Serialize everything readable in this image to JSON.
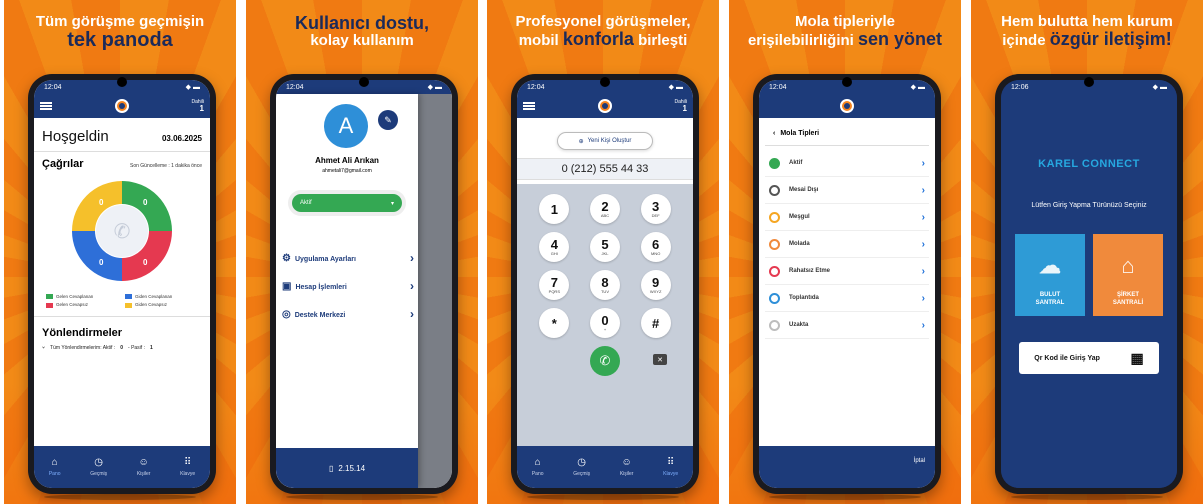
{
  "panels": {
    "p1": {
      "headline_l1": "Tüm görüşme geçmişin",
      "headline_l2": "tek panoda",
      "time": "12:04",
      "dahili_label": "Dahili",
      "dahili_value": "1",
      "welcome": "Hoşgeldin",
      "date": "03.06.2025",
      "calls_title": "Çağrılar",
      "last_update": "Son Güncelleme : 1 dakika önce",
      "donut_values": [
        "0",
        "0",
        "0",
        "0"
      ],
      "legend": [
        "Gelen Cevaplanan",
        "Giden Cevaplanan",
        "Gelen Cevapsız",
        "Giden Cevapsız"
      ],
      "redirects_title": "Yönlendirmeler",
      "redirects_text": "Tüm Yönlendirmelerim: Aktif :",
      "redirects_active": "0",
      "redirects_passive_label": "- Pasif :",
      "redirects_passive": "1"
    },
    "p2": {
      "headline_l1": "Kullanıcı dostu,",
      "headline_l2": "kolay kullanım",
      "time": "12:04",
      "avatar_letter": "A",
      "name": "Ahmet Ali Arıkan",
      "email": "ahmetali7@gmail.com",
      "status": "Aktif",
      "menu": [
        "Uygulama Ayarları",
        "Hesap İşlemleri",
        "Destek Merkezi"
      ],
      "version": "2.15.14"
    },
    "p3": {
      "headline_l1": "Profesyonel görüşmeler,",
      "headline_l2a": "mobil",
      "headline_l2b": "konforla",
      "headline_l2c": "birleşti",
      "time": "12:04",
      "dahili_label": "Dahili",
      "dahili_value": "1",
      "new_contact": "Yeni Kişi Oluştur",
      "number": "0 (212) 555 44 33",
      "keys": [
        {
          "d": "1",
          "l": ""
        },
        {
          "d": "2",
          "l": "ABC"
        },
        {
          "d": "3",
          "l": "DEF"
        },
        {
          "d": "4",
          "l": "GHI"
        },
        {
          "d": "5",
          "l": "JKL"
        },
        {
          "d": "6",
          "l": "MNO"
        },
        {
          "d": "7",
          "l": "PQRS"
        },
        {
          "d": "8",
          "l": "TUV"
        },
        {
          "d": "9",
          "l": "WXYZ"
        },
        {
          "d": "*",
          "l": ""
        },
        {
          "d": "0",
          "l": "+"
        },
        {
          "d": "#",
          "l": ""
        }
      ]
    },
    "p4": {
      "headline_l1": "Mola tipleriyle",
      "headline_l2a": "erişilebilirliğini",
      "headline_l2b": "sen yönet",
      "time": "12:04",
      "title": "Mola Tipleri",
      "breaks": [
        {
          "label": "Aktif",
          "color": "#34a853"
        },
        {
          "label": "Mesai Dışı",
          "color": "#555555"
        },
        {
          "label": "Meşgul",
          "color": "#f5a623"
        },
        {
          "label": "Molada",
          "color": "#f08a3c"
        },
        {
          "label": "Rahatsız Etme",
          "color": "#e53950"
        },
        {
          "label": "Toplantıda",
          "color": "#2e8fd8"
        },
        {
          "label": "Uzakta",
          "color": "#bdbdbd"
        }
      ],
      "cancel": "İptal"
    },
    "p5": {
      "headline_l1": "Hem bulutta hem kurum",
      "headline_l2a": "içinde",
      "headline_l2b": "özgür iletişim!",
      "time": "12:06",
      "logo": "KAREL CONNECT",
      "subtitle": "Lütfen Giriş Yapma Türünüzü Seçiniz",
      "cloud_l1": "BULUT",
      "cloud_l2": "SANTRAL",
      "company_l1": "ŞİRKET",
      "company_l2": "SANTRALİ",
      "qr_label": "Qr Kod ile Giriş Yap"
    }
  },
  "tabs": [
    "Pano",
    "Geçmiş",
    "Kişiler",
    "Klavye"
  ],
  "colors": {
    "brand_blue": "#1d3b7a",
    "orange": "#f5841f",
    "green": "#34a853",
    "donut": [
      "#f5c02b",
      "#34a853",
      "#e53950",
      "#2e6fd8"
    ]
  }
}
